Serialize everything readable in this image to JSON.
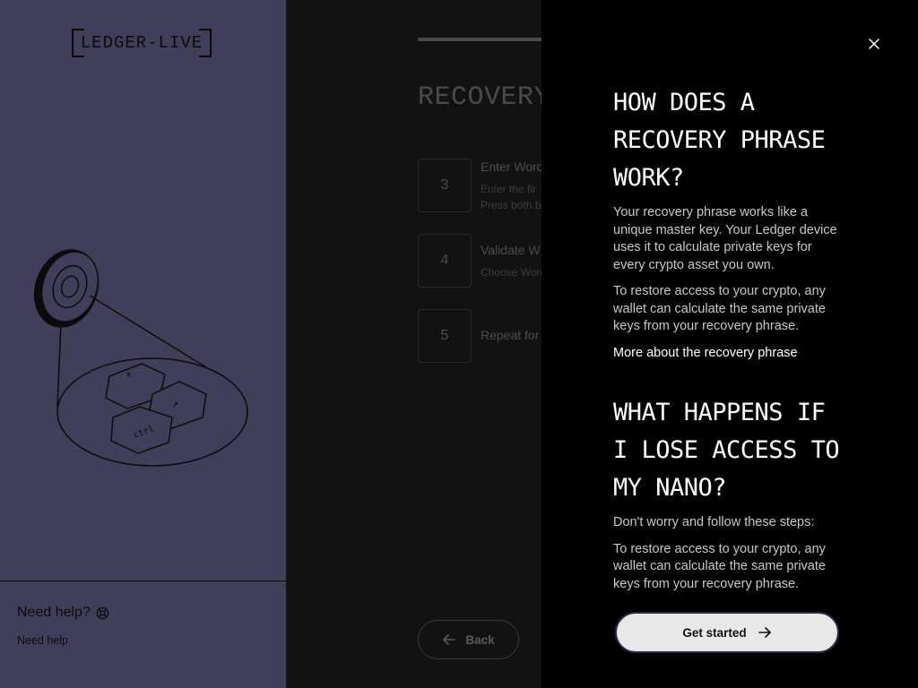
{
  "sidebar": {
    "logo_text": "LEDGER-LIVE",
    "help_title": "Need help?",
    "help_link": "Need help"
  },
  "main": {
    "title": "RECOVERY",
    "steps": [
      {
        "number": "3",
        "title": "Enter Word",
        "desc_line1": "Enter the fir",
        "desc_line2": "Press both b"
      },
      {
        "number": "4",
        "title": "Validate W",
        "desc_line1": "Choose Word"
      },
      {
        "number": "5",
        "title": "Repeat for"
      }
    ],
    "back_label": "Back"
  },
  "drawer": {
    "section1_title": "HOW DOES A RECOVERY PHRASE WORK?",
    "section1_p1": "Your recovery phrase works like a unique master key. Your Ledger device uses it to calculate private keys for every crypto asset you own.",
    "section1_p2": "To restore access to your crypto, any wallet can calculate the same private keys from your recovery phrase.",
    "section1_link": "More about the recovery phrase",
    "section2_title": "WHAT HAPPENS IF I LOSE ACCESS TO MY NANO?",
    "section2_p1": "Don't worry and follow these steps:",
    "section2_p2": "To restore access to your crypto, any wallet can calculate the same private keys from your recovery phrase.",
    "get_started_label": "Get started"
  },
  "colors": {
    "sidebar_bg": "#413e59",
    "main_bg": "#121212",
    "drawer_bg": "#000000",
    "button_bg": "#e8e8e8"
  },
  "icons": [
    "close-icon",
    "arrow-right-icon",
    "arrow-left-icon",
    "help-icon"
  ]
}
